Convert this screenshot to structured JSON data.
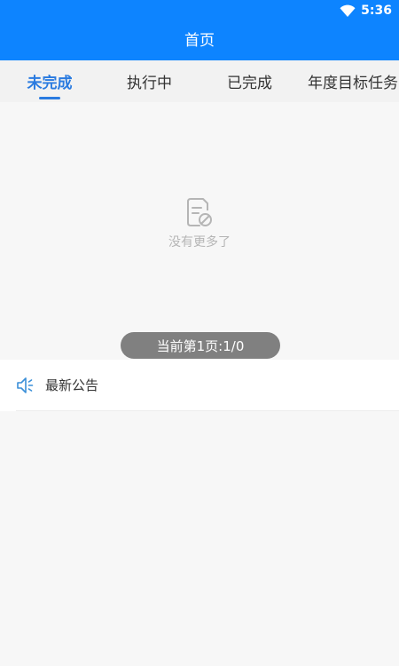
{
  "status_bar": {
    "time": "5:36",
    "wifi_icon": "wifi-icon"
  },
  "app_bar": {
    "title": "首页"
  },
  "tabs": [
    {
      "label": "未完成",
      "active": true
    },
    {
      "label": "执行中",
      "active": false
    },
    {
      "label": "已完成",
      "active": false
    },
    {
      "label": "年度目标任务",
      "active": false
    }
  ],
  "empty_state": {
    "icon": "empty-document-icon",
    "text": "没有更多了"
  },
  "pagination": {
    "text": "当前第1页:1/0"
  },
  "announcement": {
    "icon": "speaker-icon",
    "title": "最新公告"
  },
  "colors": {
    "primary": "#0d84ff",
    "tab_active": "#2a7be0",
    "background": "#f7f7f7"
  }
}
